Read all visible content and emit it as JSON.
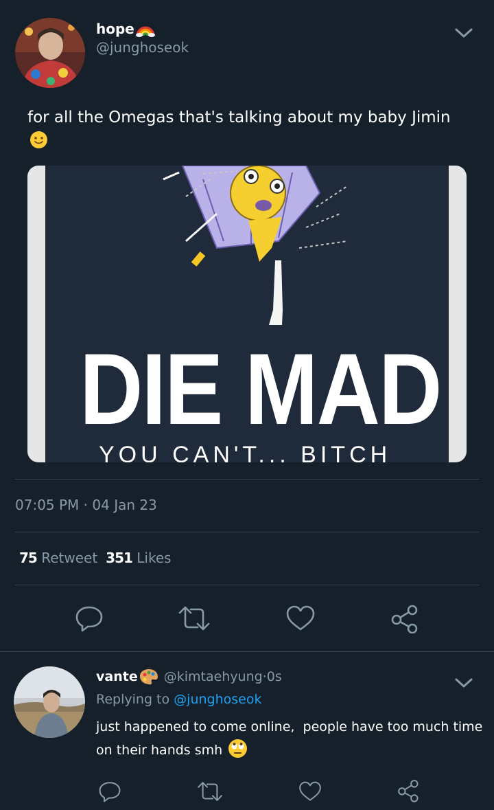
{
  "tweet": {
    "display_name": "hope",
    "name_emoji": "rainbow-emoji",
    "handle": "@junghoseok",
    "text": "for all the Omegas that's talking about my baby Jimin",
    "text_emoji": "slightly-smiling-face-emoji",
    "image": {
      "headline": "DIE MAD",
      "subline": "YOU CAN'T... BITCH"
    },
    "time": "07:05 PM",
    "date": "04 Jan 23",
    "retweet_count": "75",
    "retweet_label": "Retweet",
    "like_count": "351",
    "like_label": "Likes"
  },
  "reply": {
    "display_name": "vante",
    "name_emoji": "artist-palette-emoji",
    "handle": "@kimtaehyung",
    "age": "0s",
    "replying_label": "Replying to",
    "replying_to": "@junghoseok",
    "text": "just happened to come online,  people have too much time on their hands smh",
    "text_emoji": "face-with-rolling-eyes-emoji"
  },
  "icons": [
    "chevron-down-icon",
    "reply-icon",
    "retweet-icon",
    "like-icon",
    "share-icon"
  ],
  "colors": {
    "background": "#15202b",
    "muted": "#8899a6",
    "link": "#1da1f2",
    "divider": "#38444d"
  }
}
